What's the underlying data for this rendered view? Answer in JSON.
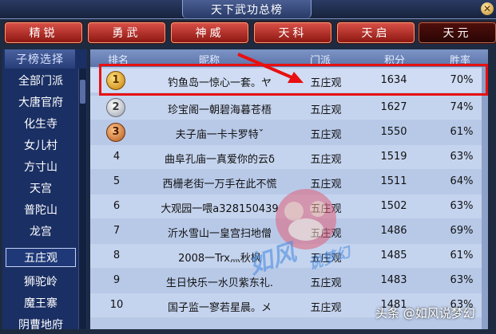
{
  "window": {
    "title": "天下武功总榜",
    "close_label": "✕"
  },
  "tabs": [
    {
      "label": "精锐",
      "active": false
    },
    {
      "label": "勇武",
      "active": false
    },
    {
      "label": "神威",
      "active": false
    },
    {
      "label": "天科",
      "active": false
    },
    {
      "label": "天启",
      "active": false
    },
    {
      "label": "天元",
      "active": true
    }
  ],
  "sidebar": {
    "header": "子榜选择",
    "items": [
      "全部门派",
      "大唐官府",
      "化生寺",
      "女儿村",
      "方寸山",
      "天宫",
      "普陀山",
      "龙宫",
      "五庄观",
      "狮驼岭",
      "魔王寨",
      "阴曹地府"
    ],
    "selected": "五庄观"
  },
  "table": {
    "headers": {
      "rank": "排名",
      "name": "昵称",
      "school": "门派",
      "score": "积分",
      "win": "胜率"
    },
    "rows": [
      {
        "rank": "1",
        "name": "钓鱼岛一惊心一套。ヤ",
        "school": "五庄观",
        "score": "1634",
        "win": "70%"
      },
      {
        "rank": "2",
        "name": "珍宝阁一朝碧海暮苍梧",
        "school": "五庄观",
        "score": "1627",
        "win": "74%"
      },
      {
        "rank": "3",
        "name": "夫子庙一卡卡罗特ˇ",
        "school": "五庄观",
        "score": "1550",
        "win": "61%"
      },
      {
        "rank": "4",
        "name": "曲阜孔庙一真爱你的云δ",
        "school": "五庄观",
        "score": "1519",
        "win": "63%"
      },
      {
        "rank": "5",
        "name": "西栅老街一万手在此不慌",
        "school": "五庄观",
        "score": "1511",
        "win": "64%"
      },
      {
        "rank": "6",
        "name": "大观园一喂a328150439",
        "school": "五庄观",
        "score": "1502",
        "win": "63%"
      },
      {
        "rank": "7",
        "name": "沂水雪山一皇宫扫地僧",
        "school": "五庄观",
        "score": "1486",
        "win": "69%"
      },
      {
        "rank": "8",
        "name": "2008一Trx灬秋枫",
        "school": "五庄观",
        "score": "1485",
        "win": "61%"
      },
      {
        "rank": "9",
        "name": "生日快乐一水贝紫东礼.",
        "school": "五庄观",
        "score": "1483",
        "win": "63%"
      },
      {
        "rank": "10",
        "name": "国子监一寥若星晨。メ",
        "school": "五庄观",
        "score": "1481",
        "win": "63%"
      }
    ]
  },
  "watermark": {
    "brand": "如风",
    "sub": "说梦幻"
  },
  "credit": "头条 @如风说梦幻",
  "colors": {
    "highlight": "#e81010",
    "tab_red": "#b8302a"
  }
}
